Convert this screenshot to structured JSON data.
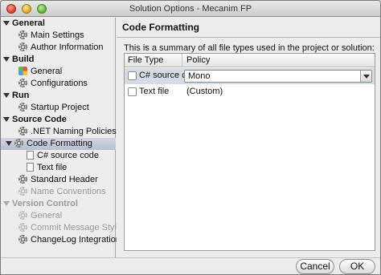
{
  "window": {
    "title": "Solution Options - Mecanim FP"
  },
  "sidebar": {
    "groups": [
      {
        "label": "General",
        "disabled": false,
        "items": [
          {
            "label": "Main Settings",
            "icon": "gear-icon",
            "disabled": false
          },
          {
            "label": "Author Information",
            "icon": "gear-icon",
            "disabled": false
          }
        ]
      },
      {
        "label": "Build",
        "disabled": false,
        "items": [
          {
            "label": "General",
            "icon": "config-icon",
            "disabled": false
          },
          {
            "label": "Configurations",
            "icon": "gear-icon",
            "disabled": false
          }
        ]
      },
      {
        "label": "Run",
        "disabled": false,
        "items": [
          {
            "label": "Startup Project",
            "icon": "gear-icon",
            "disabled": false
          }
        ]
      },
      {
        "label": "Source Code",
        "disabled": false,
        "items": [
          {
            "label": ".NET Naming Policies",
            "icon": "gear-icon",
            "disabled": false
          },
          {
            "label": "Code Formatting",
            "icon": "gear-icon",
            "disabled": false,
            "selected": true
          },
          {
            "label": "C# source code",
            "icon": "document-icon",
            "disabled": false
          },
          {
            "label": "Text file",
            "icon": "document-icon",
            "disabled": false
          },
          {
            "label": "Standard Header",
            "icon": "gear-icon",
            "disabled": false
          },
          {
            "label": "Name Conventions",
            "icon": "gear-icon",
            "disabled": true
          }
        ]
      },
      {
        "label": "Version Control",
        "disabled": true,
        "items": [
          {
            "label": "General",
            "icon": "gear-icon",
            "disabled": true
          },
          {
            "label": "Commit Message Style",
            "icon": "gear-icon",
            "disabled": true
          },
          {
            "label": "ChangeLog Integration",
            "icon": "gear-icon",
            "disabled": false
          }
        ]
      }
    ]
  },
  "main": {
    "heading": "Code Formatting",
    "summary": "This is a summary of all file types used in the project or solution:",
    "columns": {
      "file_type": "File Type",
      "policy": "Policy"
    },
    "rows": [
      {
        "file_type": "C# source code",
        "policy": "Mono",
        "selected": true
      },
      {
        "file_type": "Text file",
        "policy": "(Custom)",
        "selected": false
      }
    ]
  },
  "footer": {
    "cancel_label": "Cancel",
    "ok_label": "OK"
  }
}
